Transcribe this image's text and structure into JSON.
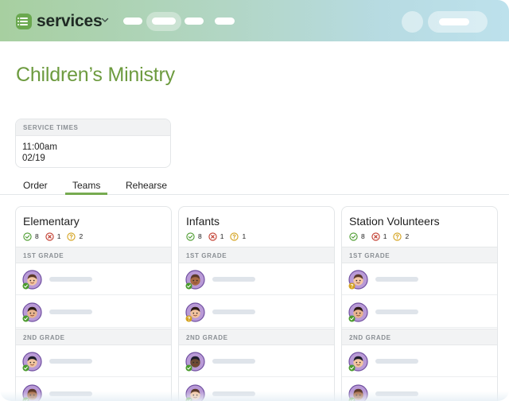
{
  "app": {
    "name": "services",
    "logo_icon": "list-icon",
    "brand_color": "#6aa84f"
  },
  "nav": {
    "items": [
      "",
      "",
      "",
      ""
    ],
    "active_index": 1
  },
  "page": {
    "title": "Children’s Ministry",
    "title_color": "#6d9b3f"
  },
  "service_times": {
    "header": "SERVICE TIMES",
    "time": "11:00am",
    "date": "02/19"
  },
  "tabs": {
    "items": [
      "Order",
      "Teams",
      "Rehearse"
    ],
    "active": "Teams",
    "accent": "#76ab50"
  },
  "teams": [
    {
      "name": "Elementary",
      "stats": {
        "confirmed": "8",
        "declined": "1",
        "pending": "2"
      },
      "sections": [
        {
          "label": "1ST GRADE",
          "members": [
            {
              "status": "confirmed"
            },
            {
              "status": "confirmed"
            }
          ]
        },
        {
          "label": "2ND GRADE",
          "members": [
            {
              "status": "confirmed"
            },
            {
              "status": "confirmed"
            }
          ]
        }
      ]
    },
    {
      "name": "Infants",
      "stats": {
        "confirmed": "8",
        "declined": "1",
        "pending": "1"
      },
      "sections": [
        {
          "label": "1ST GRADE",
          "members": [
            {
              "status": "confirmed"
            },
            {
              "status": "pending"
            }
          ]
        },
        {
          "label": "2ND GRADE",
          "members": [
            {
              "status": "confirmed"
            },
            {
              "status": "confirmed"
            }
          ]
        }
      ]
    },
    {
      "name": "Station Volunteers",
      "stats": {
        "confirmed": "8",
        "declined": "1",
        "pending": "2"
      },
      "sections": [
        {
          "label": "1ST GRADE",
          "members": [
            {
              "status": "pending"
            },
            {
              "status": "confirmed"
            }
          ]
        },
        {
          "label": "2ND GRADE",
          "members": [
            {
              "status": "confirmed"
            },
            {
              "status": "confirmed"
            }
          ]
        }
      ]
    }
  ],
  "status_colors": {
    "confirmed": "#4a9a2c",
    "declined": "#c0392b",
    "pending": "#d4a21d"
  }
}
